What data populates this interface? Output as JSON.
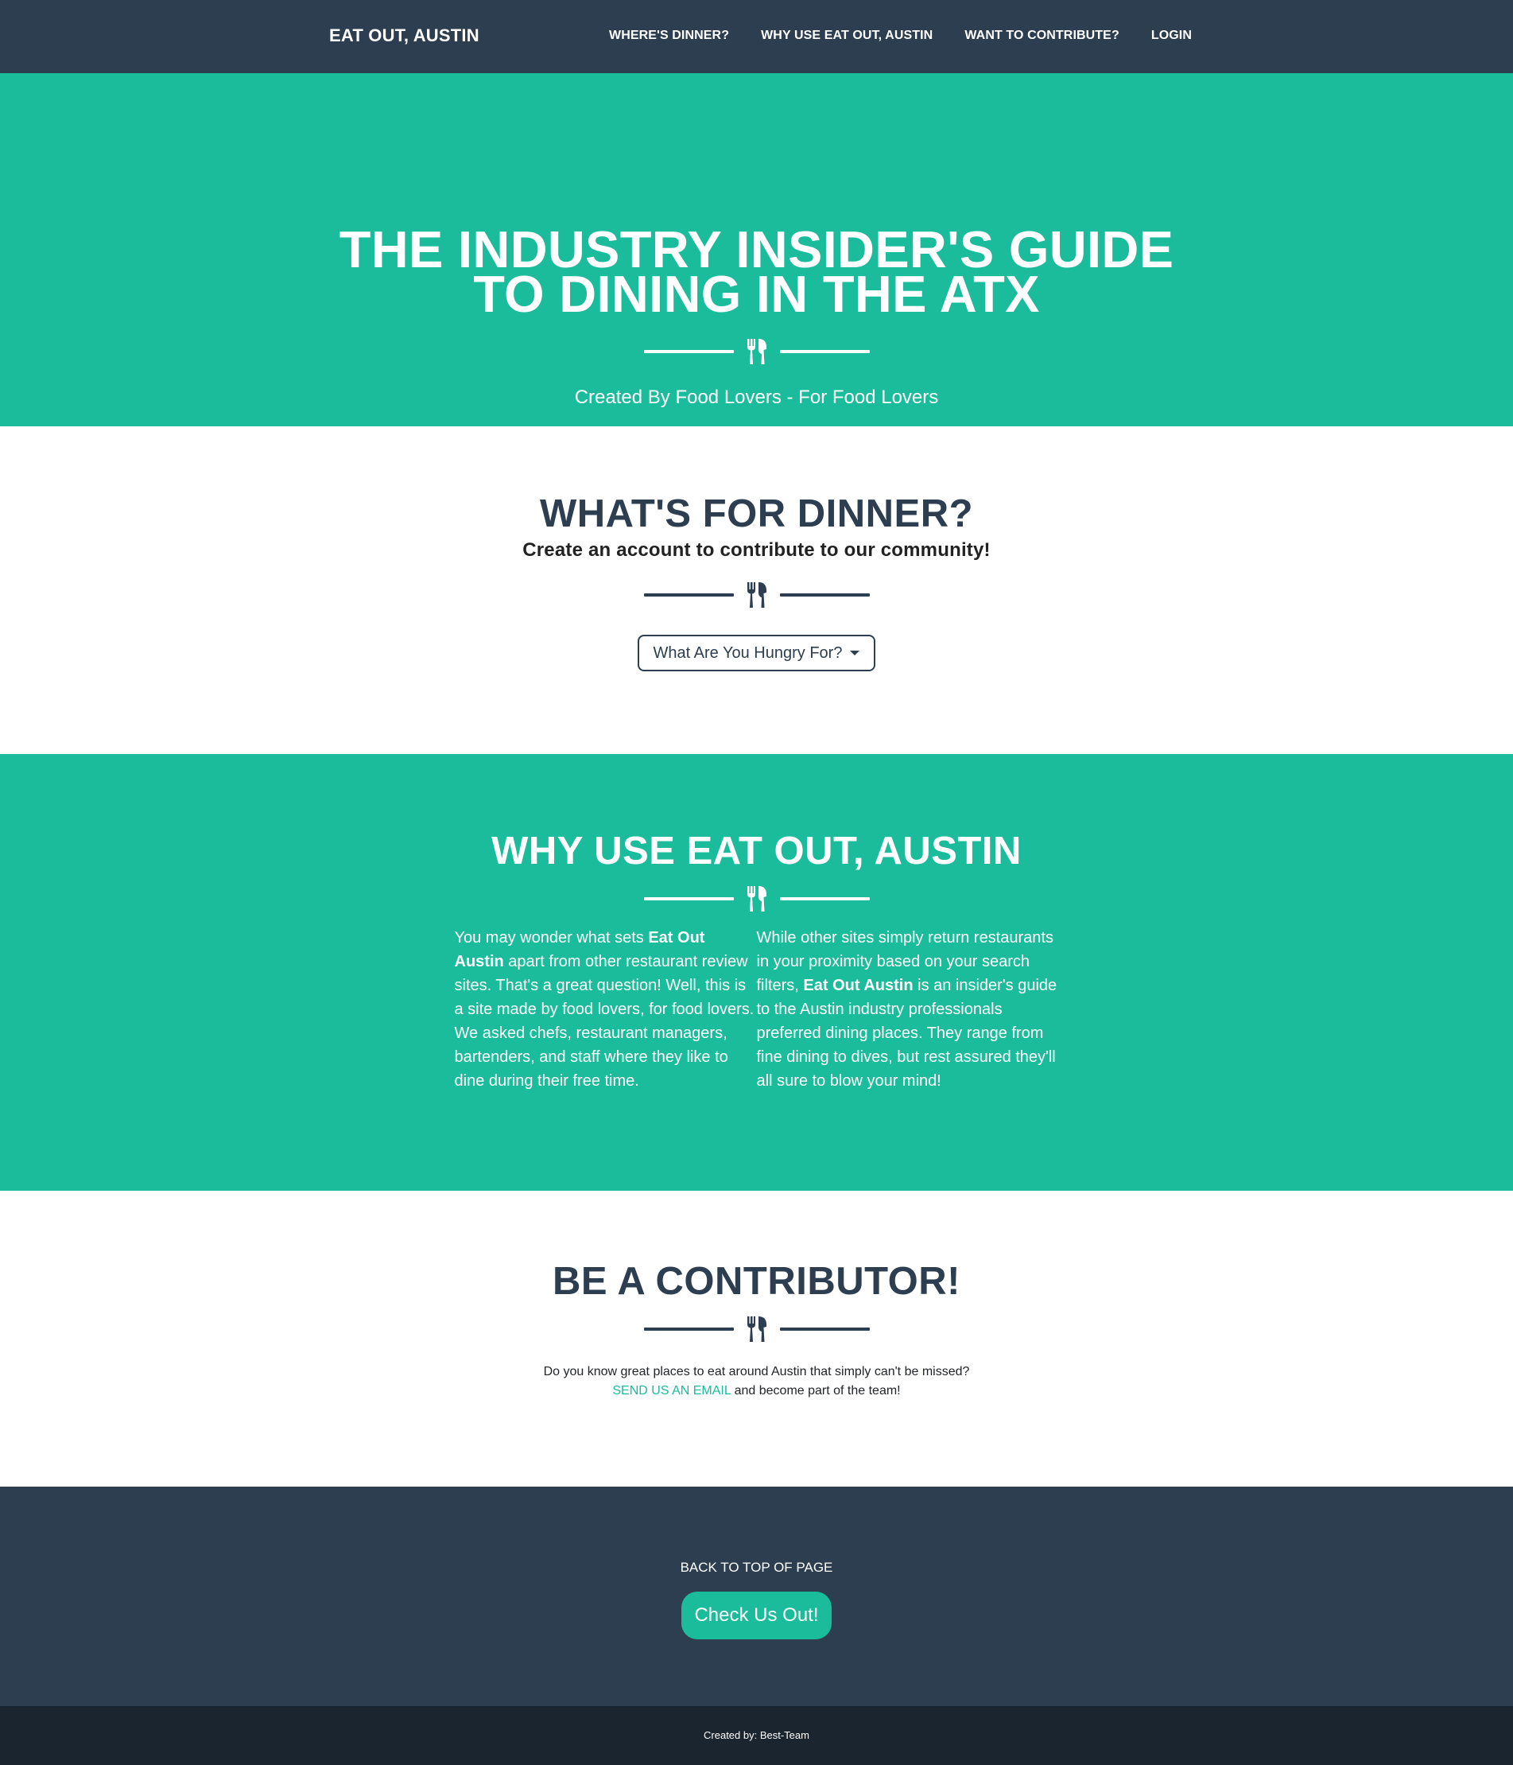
{
  "colors": {
    "primary": "#1abc9c",
    "dark": "#2c3e50",
    "darker": "#1a252f",
    "white": "#ffffff"
  },
  "navbar": {
    "brand": "EAT OUT, AUSTIN",
    "links": [
      "WHERE'S DINNER?",
      "WHY USE EAT OUT, AUSTIN",
      "WANT TO CONTRIBUTE?",
      "LOGIN"
    ]
  },
  "masthead": {
    "title_line1": "THE INDUSTRY INSIDER'S GUIDE",
    "title_line2": "TO DINING IN THE ATX",
    "divider_icon": "utensils-icon",
    "subtitle": "Created By Food Lovers - For Food Lovers"
  },
  "dinner": {
    "heading": "WHAT'S FOR DINNER?",
    "tagline": "Create an account to contribute to our community!",
    "dropdown_label": "What Are You Hungry For?"
  },
  "about": {
    "heading": "WHY USE EAT OUT, AUSTIN",
    "col1": {
      "p1": "You may wonder what sets ",
      "b1": "Eat Out Austin",
      "p2": " apart from other restaurant review sites. That's a great question! Well, this is a site made by food lovers, for food lovers. We asked chefs, restaurant managers, bartenders, and staff where they like to dine during their free time."
    },
    "col2": {
      "p1": "While other sites simply return restaurants in your proximity based on your search filters, ",
      "b1": "Eat Out Austin",
      "p2": " is an insider's guide to the Austin industry professionals preferred dining places. They range from fine dining to dives, but rest assured they'll all sure to blow your mind!"
    }
  },
  "contribute": {
    "heading": "BE A CONTRIBUTOR!",
    "line1": "Do you know great places to eat around Austin that simply can't be missed?",
    "email_link": "SEND US AN EMAIL",
    "line2_rest": " and become part of the team!"
  },
  "footer": {
    "back_to_top": "BACK TO TOP OF PAGE",
    "cta": "Check Us Out!"
  },
  "copyright": {
    "text": "Created by: Best-Team"
  }
}
